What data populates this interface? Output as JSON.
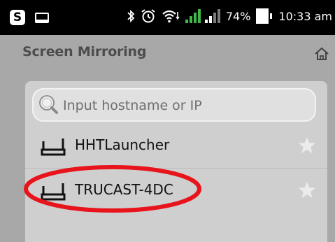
{
  "status_bar": {
    "battery_percent": "74%",
    "time": "10:33 am",
    "icons": [
      "s-app-icon",
      "message-icon",
      "bluetooth-icon",
      "alarm-icon",
      "wifi-icon",
      "signal-icon",
      "battery-icon"
    ]
  },
  "header": {
    "title": "Screen Mirroring",
    "home_icon": "home-icon"
  },
  "search": {
    "placeholder": "Input hostname or IP",
    "value": ""
  },
  "devices": [
    {
      "name": "HHTLauncher",
      "favorite": false
    },
    {
      "name": "TRUCAST-4DC",
      "favorite": false,
      "highlighted": true
    }
  ],
  "colors": {
    "status_bar": "#000000",
    "background": "#a8a8a8",
    "panel": "#cfcfcf",
    "signal_green": "#3fb84a",
    "highlight": "#e8141b"
  }
}
